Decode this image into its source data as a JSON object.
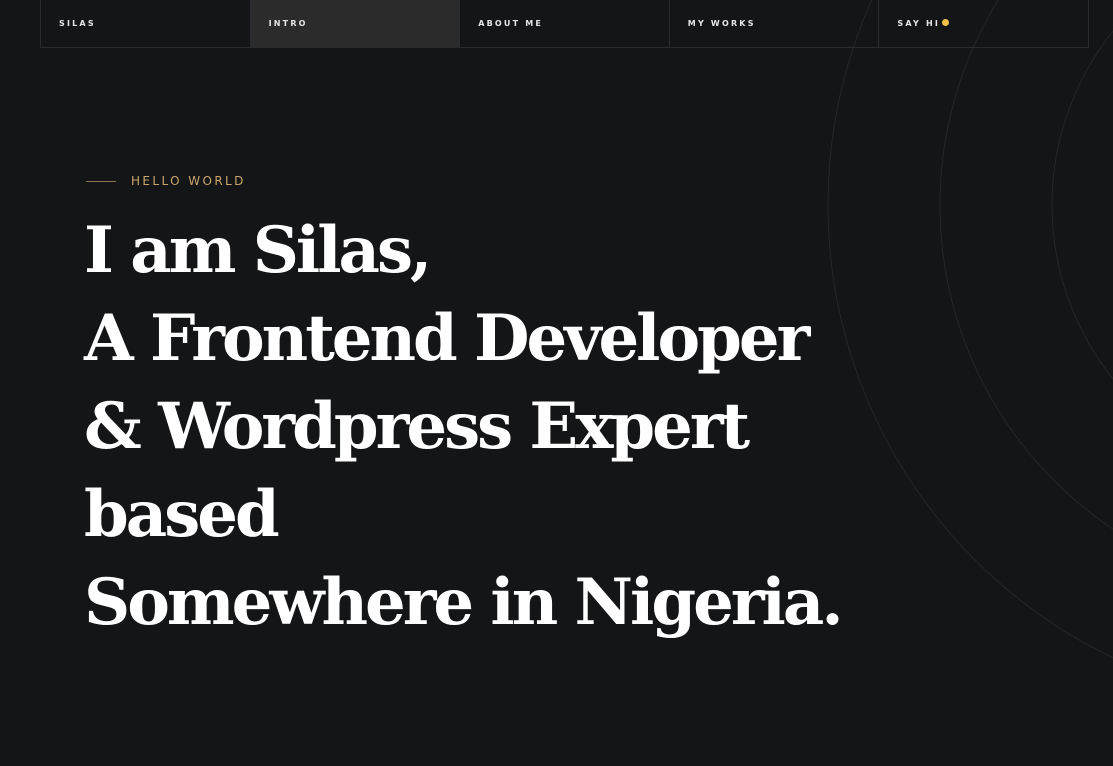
{
  "nav": {
    "items": [
      {
        "label": "SILAS"
      },
      {
        "label": "INTRO"
      },
      {
        "label": "ABOUT ME"
      },
      {
        "label": "MY WORKS"
      },
      {
        "label": "SAY HI"
      }
    ],
    "active_index": 1,
    "say_hi_icon": "smile-emoji-icon"
  },
  "hero": {
    "eyebrow": "HELLO WORLD",
    "lines": [
      "I am Silas,",
      "A Frontend Developer",
      "& Wordpress Expert",
      "based",
      "Somewhere in Nigeria."
    ]
  },
  "colors": {
    "background": "#141517",
    "accent": "#caa46a",
    "active_nav": "#2b2b2b"
  }
}
